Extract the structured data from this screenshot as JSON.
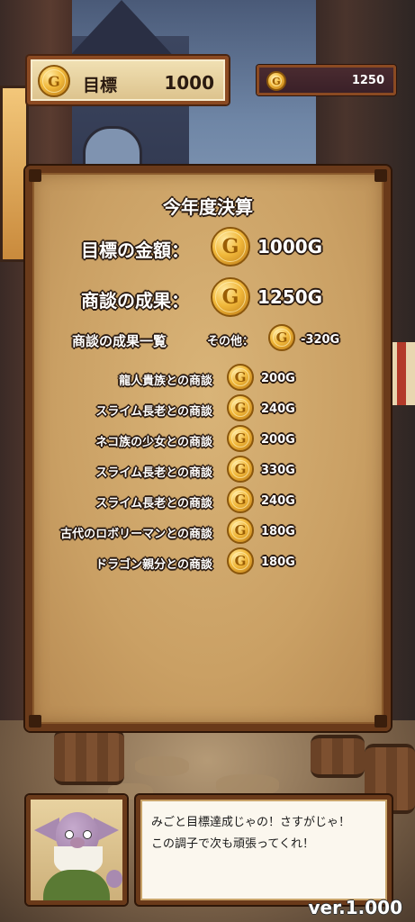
{
  "hud": {
    "target_label": "目標",
    "target_value": "1000",
    "money_value": "1250"
  },
  "coin_glyph": "G",
  "panel": {
    "title": "今年度決算",
    "target_amount_label": "目標の金額：",
    "target_amount_value": "1000G",
    "result_label": "商談の成果：",
    "result_value": "1250G",
    "list_header": "商談の成果一覧",
    "other_label": "その他：",
    "other_value": "-320G",
    "deals": [
      {
        "label": "龍人貴族との商談",
        "value": "200G"
      },
      {
        "label": "スライム長老との商談",
        "value": "240G"
      },
      {
        "label": "ネコ族の少女との商談",
        "value": "200G"
      },
      {
        "label": "スライム長老との商談",
        "value": "330G"
      },
      {
        "label": "スライム長老との商談",
        "value": "240G"
      },
      {
        "label": "古代のロボリーマンとの商談",
        "value": "180G"
      },
      {
        "label": "ドラゴン親分との商談",
        "value": "180G"
      }
    ]
  },
  "dialog": {
    "text": "みごと目標達成じゃの！さすがじゃ！\nこの調子で次も頑張ってくれ！"
  },
  "version": "ver.1.000",
  "colors": {
    "panel_border": "#6a3a1a",
    "panel_bg": "#caa064",
    "coin_gold": "#f1b83a",
    "text_outline": "#2a1a10"
  }
}
